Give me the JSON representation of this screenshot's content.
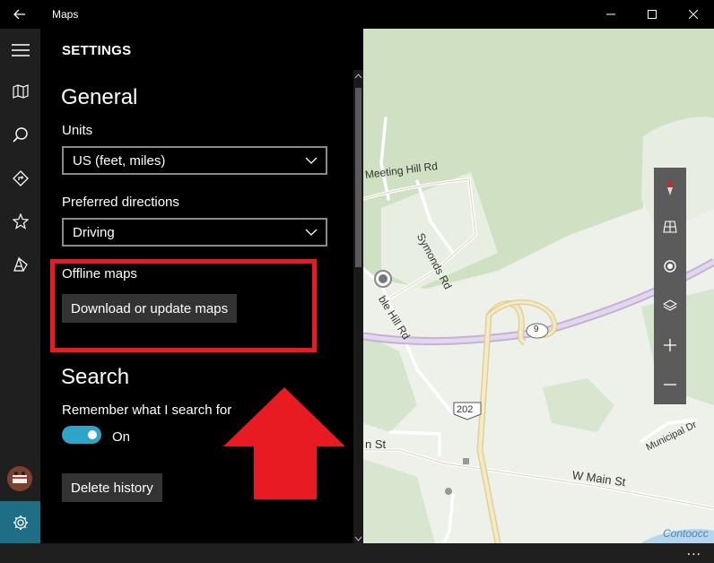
{
  "window": {
    "title": "Maps",
    "back_icon": "back-arrow-icon",
    "minimize_icon": "minimize-icon",
    "maximize_icon": "maximize-icon",
    "close_icon": "close-icon"
  },
  "rail": {
    "items": [
      "hamburger-menu-icon",
      "map-icon",
      "search-icon",
      "directions-icon",
      "favorites-star-icon",
      "3d-cities-icon"
    ],
    "settings_icon": "gear-icon"
  },
  "settings": {
    "header": "SETTINGS",
    "general": {
      "heading": "General",
      "units_label": "Units",
      "units_value": "US (feet, miles)",
      "directions_label": "Preferred directions",
      "directions_value": "Driving",
      "offline_label": "Offline maps",
      "offline_button": "Download or update maps"
    },
    "search": {
      "heading": "Search",
      "remember_label": "Remember what I search for",
      "toggle_state": "On",
      "delete_button": "Delete history"
    }
  },
  "map": {
    "labels": {
      "meeting_hill": "Meeting Hill Rd",
      "symonds": "Symonds Rd",
      "dublin_hill": "ble Hill Rd",
      "route_9": "9",
      "route_202": "202",
      "main_st": "n St",
      "w_main_st": "W Main St",
      "municipal": "Municipal Dr",
      "water": "Contoocc"
    },
    "controls": [
      "compass-icon",
      "3d-tilt-icon",
      "my-location-icon",
      "map-layers-icon",
      "zoom-in-icon",
      "zoom-out-icon"
    ]
  },
  "bottombar": {
    "more": "..."
  },
  "colors": {
    "accent": "#2ea4c8",
    "annotation_red": "#e81b23",
    "map_land": "#eef0ea",
    "map_green": "#cfe0c3",
    "highway": "#d8c8e8"
  }
}
